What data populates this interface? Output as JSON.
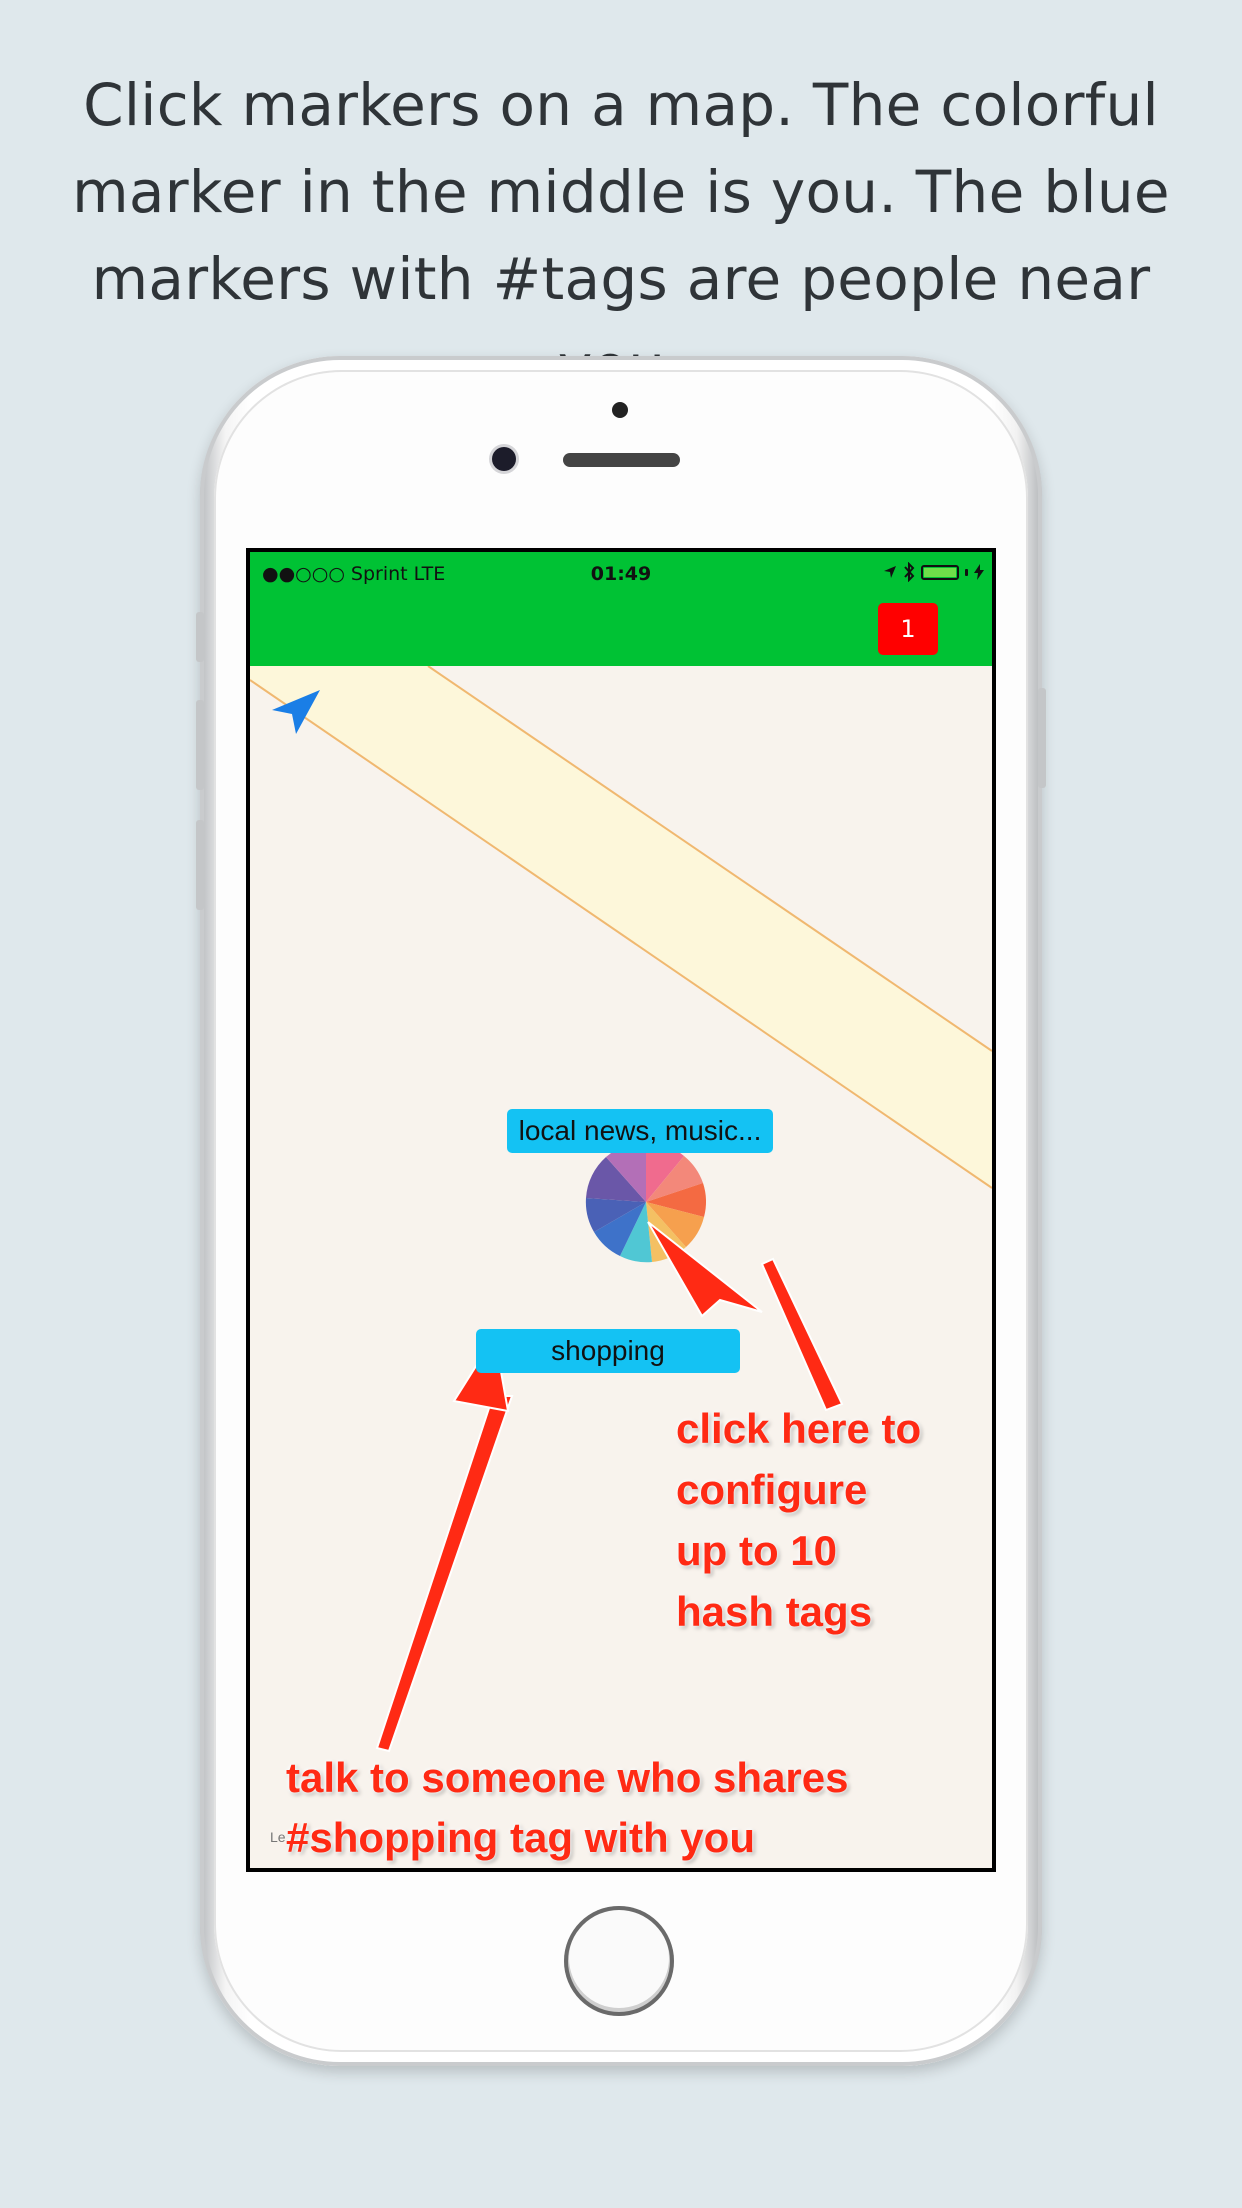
{
  "caption": {
    "line1": "Click markers on a map. The colorful",
    "line2": "marker in the middle is you. The blue",
    "line3": "markers with #tags are people near you."
  },
  "status_bar": {
    "carrier": "●●○○○ Sprint   LTE",
    "time": "01:49"
  },
  "nav_bar": {
    "badge_count": "1"
  },
  "map": {
    "my_tags_label": "local news, music...",
    "nearby_tag_label": "shopping",
    "legal_label": "Le",
    "location_icon": "location-arrow-icon"
  },
  "annotations": {
    "configure": [
      "click here to",
      "configure",
      "up to 10",
      "hash tags"
    ],
    "talk": [
      "talk to someone who shares",
      "#shopping tag with you"
    ]
  },
  "colors": {
    "nav_green": "#00c234",
    "badge_red": "#ff0000",
    "tag_blue": "#14c2f3",
    "annotation_red": "#ff2a14",
    "map_background": "#f8f3ed",
    "road_fill": "#fdf7da"
  }
}
